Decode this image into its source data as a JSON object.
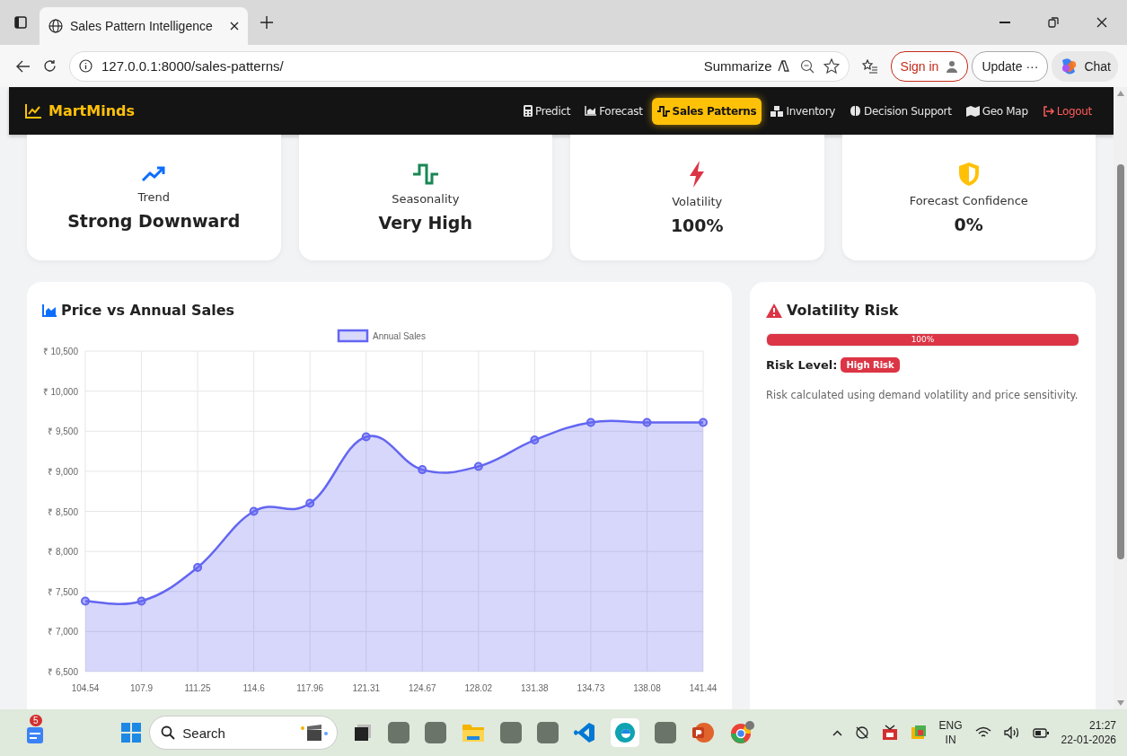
{
  "browser": {
    "tab_title": "Sales Pattern Intelligence",
    "url": "127.0.0.1:8000/sales-patterns/",
    "summarize": "Summarize",
    "sign_in": "Sign in",
    "update": "Update ···",
    "chat": "Chat"
  },
  "navbar": {
    "brand": "MartMinds",
    "items": [
      {
        "label": "Predict",
        "kind": "calculator",
        "selected": false
      },
      {
        "label": "Forecast",
        "kind": "chart",
        "selected": false
      },
      {
        "label": "Sales Patterns",
        "kind": "wave",
        "selected": true
      },
      {
        "label": "Inventory",
        "kind": "boxes",
        "selected": false
      },
      {
        "label": "Decision Support",
        "kind": "brain",
        "selected": false
      },
      {
        "label": "Geo Map",
        "kind": "map",
        "selected": false
      },
      {
        "label": "Logout",
        "kind": "logout",
        "selected": false
      }
    ]
  },
  "stats": [
    {
      "kind": "trend",
      "label": "Trend",
      "value": "Strong Downward"
    },
    {
      "kind": "seasonality",
      "label": "Seasonality",
      "value": "Very High"
    },
    {
      "kind": "volatility",
      "label": "Volatility",
      "value": "100%"
    },
    {
      "kind": "confidence",
      "label": "Forecast Confidence",
      "value": "0%"
    }
  ],
  "chart_panel": {
    "title": "Price vs Annual Sales",
    "chart_data": {
      "type": "area",
      "categories": [
        "104.54",
        "107.9",
        "111.25",
        "114.6",
        "117.96",
        "121.31",
        "124.67",
        "128.02",
        "131.38",
        "134.73",
        "138.08",
        "141.44"
      ],
      "series": [
        {
          "name": "Annual Sales",
          "color": "#6366f1",
          "values": [
            7380,
            7380,
            7800,
            8500,
            8600,
            9430,
            9020,
            9060,
            9390,
            9610,
            9610,
            9610
          ]
        }
      ],
      "ylim": [
        6500,
        10500
      ],
      "grid": true,
      "yticks": [
        {
          "value": 6500,
          "label": "₹ 6,500"
        },
        {
          "value": 7000,
          "label": "₹ 7,000"
        },
        {
          "value": 7500,
          "label": "₹ 7,500"
        },
        {
          "value": 8000,
          "label": "₹ 8,000"
        },
        {
          "value": 8500,
          "label": "₹ 8,500"
        },
        {
          "value": 9000,
          "label": "₹ 9,000"
        },
        {
          "value": 9500,
          "label": "₹ 9,500"
        },
        {
          "value": 10000,
          "label": "₹ 10,000"
        },
        {
          "value": 10500,
          "label": "₹ 10,500"
        }
      ]
    }
  },
  "risk_panel": {
    "title": "Volatility Risk",
    "level": 1.0,
    "reading": "100%",
    "risk_label": "Risk Level:",
    "badge": "High Risk",
    "note": "Risk calculated using demand volatility and price sensitivity."
  },
  "taskbar": {
    "badge": "5",
    "search": "Search",
    "lang": "ENG",
    "region": "IN",
    "time": "21:27",
    "date": "22-01-2026"
  }
}
